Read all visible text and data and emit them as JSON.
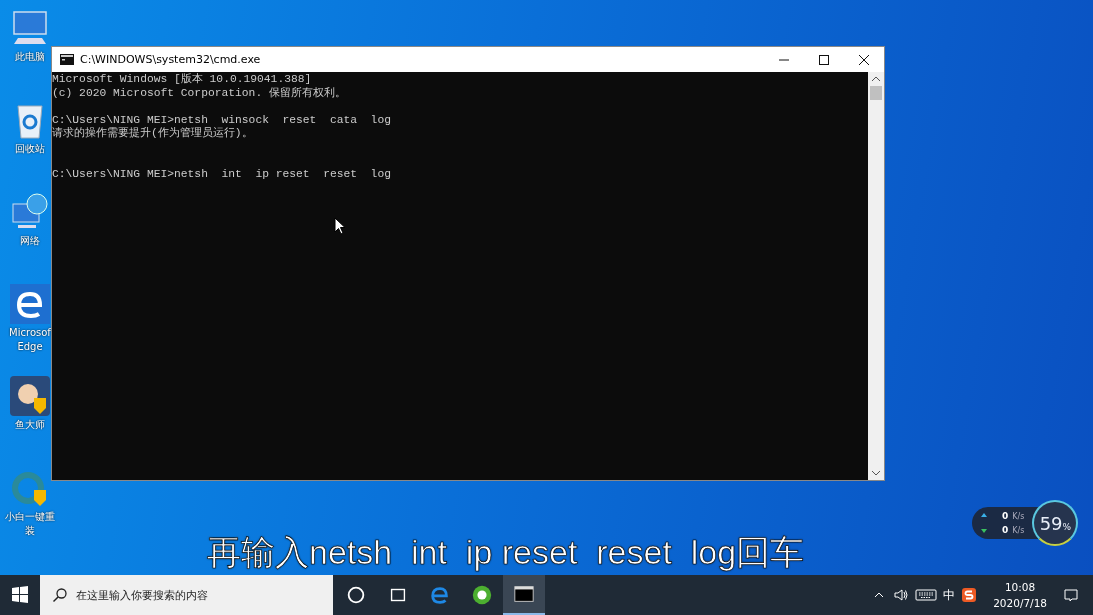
{
  "desktop_icons": [
    {
      "kind": "computer",
      "lines": [
        "此电脑"
      ]
    },
    {
      "kind": "recycle",
      "lines": [
        "回收站"
      ]
    },
    {
      "kind": "network",
      "lines": [
        "网络"
      ]
    },
    {
      "kind": "edge",
      "lines": [
        "Microsof",
        "Edge"
      ]
    },
    {
      "kind": "master",
      "lines": [
        "鱼大师"
      ]
    },
    {
      "kind": "reinstall",
      "lines": [
        "小白一键重",
        "装"
      ]
    }
  ],
  "window": {
    "title": "C:\\WINDOWS\\system32\\cmd.exe",
    "console": [
      [
        "Microsoft Windows [版本 10.0.19041.388]",
        "(c) 2020 Microsoft Corporation. 保留所有权利。"
      ],
      [
        "C:\\Users\\NING MEI>netsh  winsock  reset  cata  log",
        "请求的操作需要提升(作为管理员运行)。"
      ],
      [
        "C:\\Users\\NING MEI>netsh  int  ip reset  reset  log"
      ]
    ]
  },
  "net_widget": {
    "upload": "0",
    "upload_unit": "K/s",
    "download": "0",
    "download_unit": "K/s",
    "percent": "59",
    "percent_sign": "%"
  },
  "taskbar": {
    "search": {
      "placeholder": "在这里输入你要搜索的内容"
    },
    "apps": [
      {
        "kind": "cortana",
        "selected": false
      },
      {
        "kind": "taskview",
        "selected": false
      },
      {
        "kind": "edge",
        "selected": false
      },
      {
        "kind": "browser360",
        "selected": false
      },
      {
        "kind": "cmd",
        "selected": true
      }
    ],
    "ime": "中",
    "time": "10:08",
    "date": "2020/7/18"
  },
  "subtitle": "再输入netsh  int  ip reset  reset  log回车"
}
